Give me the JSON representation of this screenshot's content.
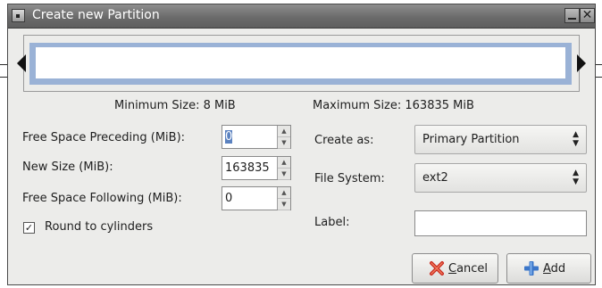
{
  "window": {
    "title": "Create new Partition"
  },
  "sizes": {
    "minimum": "Minimum Size: 8 MiB",
    "maximum": "Maximum Size: 163835 MiB"
  },
  "fields": {
    "preceding": {
      "label": "Free Space Preceding (MiB):",
      "value": "0"
    },
    "new_size": {
      "label": "New Size (MiB):",
      "value": "163835"
    },
    "following": {
      "label": "Free Space Following (MiB):",
      "value": "0"
    }
  },
  "round": {
    "label": "Round to cylinders",
    "checked": true,
    "mark": "✓"
  },
  "create_as": {
    "label": "Create as:",
    "value": "Primary Partition"
  },
  "file_system": {
    "label": "File System:",
    "value": "ext2"
  },
  "label_field": {
    "label": "Label:",
    "value": ""
  },
  "buttons": {
    "cancel": {
      "mnemonic": "C",
      "rest": "ancel"
    },
    "add": {
      "mnemonic": "A",
      "rest": "dd"
    }
  },
  "colors": {
    "selection": "#5b82c0",
    "partition_bar": "#9ab2d6"
  }
}
